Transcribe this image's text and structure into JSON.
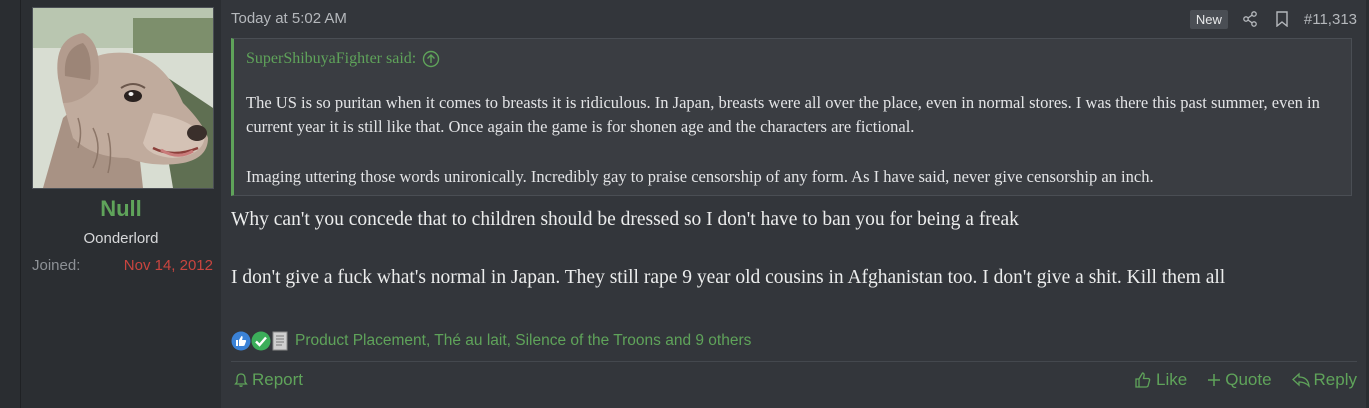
{
  "user": {
    "name": "Null",
    "title": "Oonderlord",
    "joined_label": "Joined:",
    "joined_date": "Nov 14, 2012"
  },
  "post": {
    "timestamp": "Today at 5:02 AM",
    "badge": "New",
    "number": "#11,313",
    "quote": {
      "author": "SuperShibuyaFighter said:",
      "paragraphs": [
        "The US is so puritan when it comes to breasts it is ridiculous. In Japan, breasts were all over the place, even in normal stores. I was there this past summer, even in current year it is still like that. Once again the game is for shonen age and the characters are fictional.",
        "Imaging uttering those words unironically. Incredibly gay to praise censorship of any form. As I have said, never give censorship an inch."
      ]
    },
    "body": [
      "Why can't you concede that to children should be dressed so I don't have to ban you for being a freak",
      "I don't give a fuck what's normal in Japan. They still rape 9 year old cousins in Afghanistan too. I don't give a shit. Kill them all"
    ],
    "reactions": {
      "icons": [
        "like-reaction-icon",
        "check-reaction-icon",
        "document-reaction-icon"
      ],
      "text": "Product Placement, Thé au lait, Silence of the Troons and 9 others"
    }
  },
  "actions": {
    "report": "Report",
    "like": "Like",
    "quote": "Quote",
    "reply": "Reply"
  },
  "colors": {
    "accent": "#5fa35a",
    "joined_date": "#c9453f",
    "background": "#33363b"
  }
}
